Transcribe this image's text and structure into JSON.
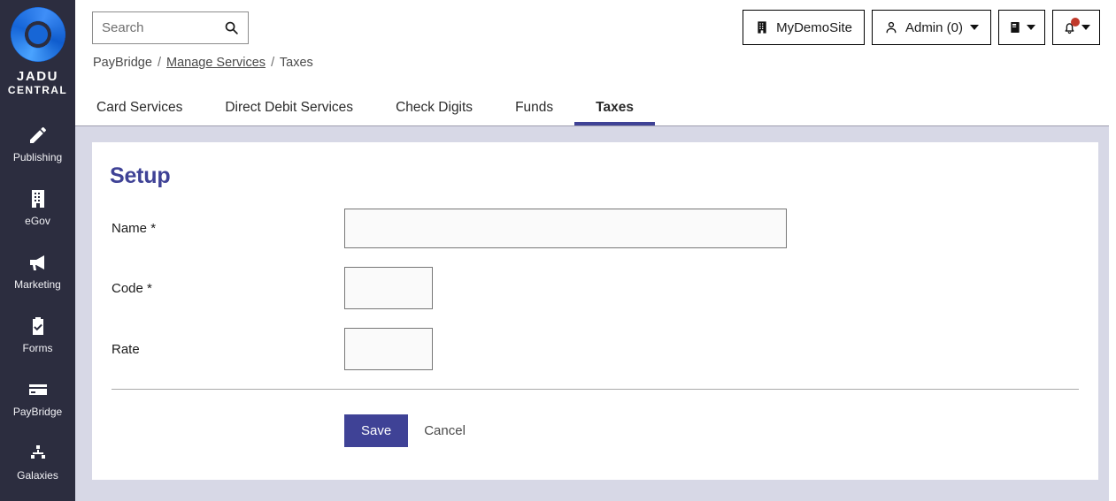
{
  "brand": {
    "name_line1": "JADU",
    "name_line2": "CENTRAL",
    "logo_icon": "jadu-ring-logo"
  },
  "sidebar": {
    "items": [
      {
        "label": "Publishing",
        "icon": "pencil-icon"
      },
      {
        "label": "eGov",
        "icon": "building-icon"
      },
      {
        "label": "Marketing",
        "icon": "megaphone-icon"
      },
      {
        "label": "Forms",
        "icon": "clipboard-check-icon"
      },
      {
        "label": "PayBridge",
        "icon": "credit-card-icon"
      },
      {
        "label": "Galaxies",
        "icon": "sitemap-icon"
      }
    ]
  },
  "search": {
    "placeholder": "Search",
    "value": "",
    "icon": "search-icon"
  },
  "breadcrumb": {
    "root": "PayBridge",
    "sep": "/",
    "link": "Manage Services",
    "current": "Taxes"
  },
  "header_buttons": {
    "site": {
      "label": "MyDemoSite",
      "icon": "building-icon"
    },
    "admin": {
      "label": "Admin (0)",
      "icon": "user-icon",
      "caret": "chevron-down-icon"
    },
    "manual": {
      "label": "",
      "icon": "book-icon",
      "caret": "chevron-down-icon"
    },
    "notifications": {
      "label": "",
      "icon": "bell-icon",
      "caret": "chevron-down-icon",
      "badge_color": "#c0392b"
    }
  },
  "tabs": [
    {
      "label": "Card Services",
      "active": false
    },
    {
      "label": "Direct Debit Services",
      "active": false
    },
    {
      "label": "Check Digits",
      "active": false
    },
    {
      "label": "Funds",
      "active": false
    },
    {
      "label": "Taxes",
      "active": true
    }
  ],
  "setup": {
    "title": "Setup",
    "fields": [
      {
        "label": "Name",
        "required": "*",
        "value": "",
        "size": "wide"
      },
      {
        "label": "Code",
        "required": "*",
        "value": "",
        "size": "small"
      },
      {
        "label": "Rate",
        "required": "",
        "value": "",
        "size": "small"
      }
    ],
    "save_label": "Save",
    "cancel_label": "Cancel"
  },
  "colors": {
    "accent": "#3f4296",
    "sidebar_bg": "#2c2d3f",
    "page_bg": "#d7d8e6",
    "badge_red": "#c0392b"
  }
}
